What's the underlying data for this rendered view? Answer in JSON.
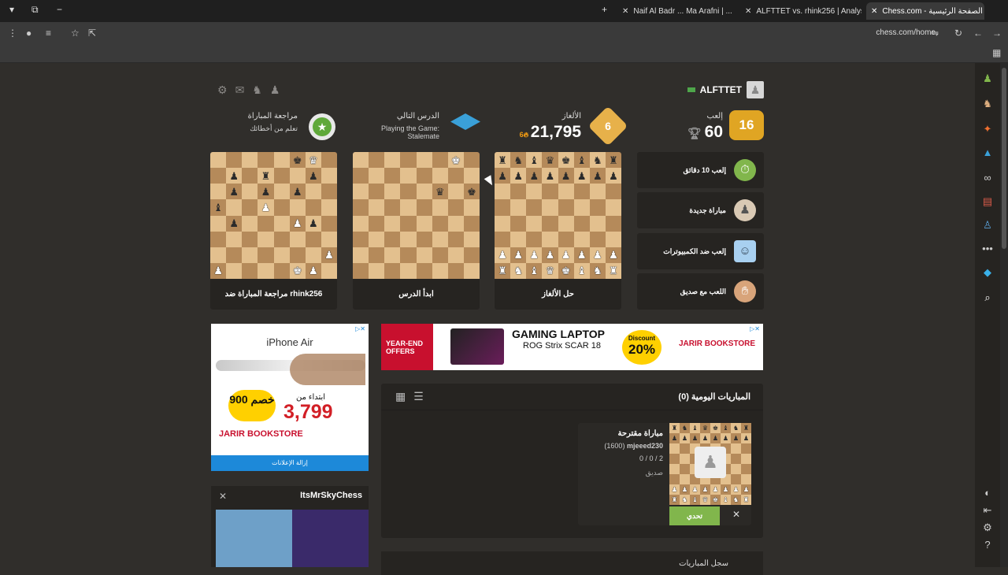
{
  "browser": {
    "tabs": [
      {
        "title": "Naif Al Badr ... Ma Arafni | ..."
      },
      {
        "title": "ALFTTET vs. rhink256 | Analysis"
      },
      {
        "title": "Chess.com - الصفحة الرئيسية"
      }
    ],
    "url": "chess.com/home"
  },
  "user": {
    "username": "ALFTTET"
  },
  "stats": {
    "play": {
      "label": "إلعب",
      "value": "60",
      "badge": "16"
    },
    "puzzles": {
      "label": "الألغاز",
      "value": "21,795",
      "streak": "6",
      "badge": "6"
    },
    "lesson": {
      "label": "الدرس التالي",
      "subtitle": "Playing the Game: Stalemate"
    },
    "review": {
      "label": "مراجعة المباراة",
      "subtitle": "تعلم من أخطائك"
    }
  },
  "cards": [
    {
      "title": "مراجعة المباراة ضد rhink256"
    },
    {
      "title": "ابدأ الدرس"
    },
    {
      "title": "حل الألغاز"
    }
  ],
  "play_buttons": [
    {
      "label": "إلعب 10 دقائق",
      "icon": "stopwatch-icon"
    },
    {
      "label": "مباراة جديدة",
      "icon": "pawn-hand-icon"
    },
    {
      "label": "إلعب ضد الكمبيوترات",
      "icon": "computer-icon"
    },
    {
      "label": "اللعب مع صديق",
      "icon": "handshake-icon"
    }
  ],
  "ads": {
    "left": {
      "title": "iPhone Air",
      "from": "ابتداء من",
      "price": "3,799",
      "discount": "خصم 900",
      "brand": "JARIR BOOKSTORE",
      "remove": "إزالة الإعلانات"
    },
    "banner": {
      "tag": "YEAR-END OFFERS",
      "title": "GAMING LAPTOP",
      "model": "ROG Strix SCAR 18",
      "discount_label": "Discount",
      "discount": "20%",
      "brand": "JARIR BOOKSTORE"
    }
  },
  "stream": {
    "name": "ItsMrSkyChess"
  },
  "daily": {
    "title": "المباريات اليومية (0)",
    "suggested": {
      "title": "مباراة مقترحة",
      "opponent": "mjeeed230",
      "rating": "(1600)",
      "record": "0 / 0 / 2",
      "relation": "صديق",
      "challenge": "تحدي"
    }
  },
  "history": {
    "title": "سجل المباريات"
  }
}
